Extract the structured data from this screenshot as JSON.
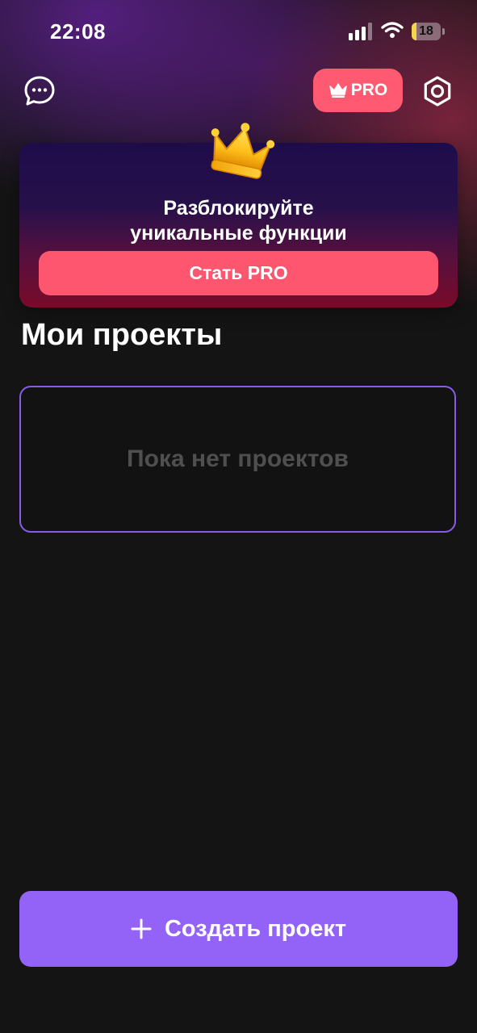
{
  "status_bar": {
    "time": "22:08",
    "battery_level": "18",
    "battery_fraction": 0.18,
    "icons": [
      "signal-icon",
      "wifi-icon",
      "battery-icon"
    ]
  },
  "top_bar": {
    "chat_icon": "chat-bubble-icon",
    "pro_button_label": "PRO",
    "pro_icon": "crown-icon",
    "settings_icon": "gear-icon"
  },
  "promo": {
    "icon": "crown-icon",
    "title": "Разблокируйте\nуникальные функции",
    "button_label": "Стать PRO"
  },
  "projects": {
    "title": "Мои проекты",
    "empty_text": "Пока нет проектов"
  },
  "create_button": {
    "icon": "plus-icon",
    "label": "Создать проект"
  },
  "colors": {
    "background": "#141414",
    "pro_accent": "#ff5a72",
    "primary_accent": "#9363f7",
    "empty_card_border": "#8a5ce6",
    "battery_fill": "#f5d54a"
  }
}
